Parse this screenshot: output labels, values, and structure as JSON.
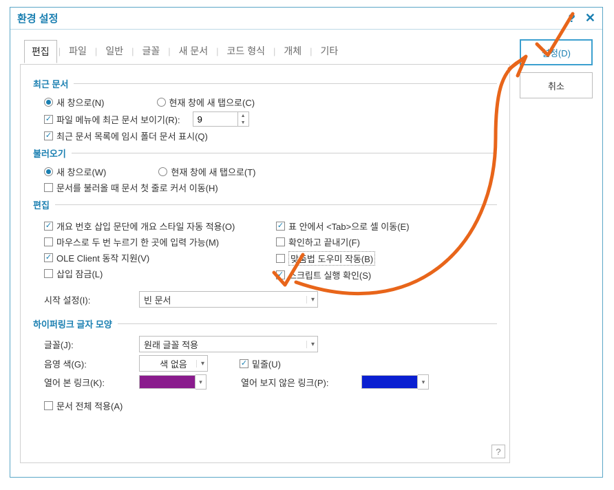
{
  "dialog": {
    "title": "환경 설정"
  },
  "buttons": {
    "ok": "설정(D)",
    "cancel": "취소"
  },
  "tabs": [
    "편집",
    "파일",
    "일반",
    "글꼴",
    "새 문서",
    "코드 형식",
    "개체",
    "기타"
  ],
  "sections": {
    "recent": {
      "title": "최근 문서"
    },
    "open": {
      "title": "불러오기"
    },
    "edit": {
      "title": "편집"
    },
    "hyperlink": {
      "title": "하이퍼링크 글자 모양"
    }
  },
  "labels": {
    "new_window_n": "새 창으로(N)",
    "new_tab_c": "현재 창에 새 탭으로(C)",
    "show_recent_menu_r": "파일 메뉴에 최근 문서 보이기(R):",
    "recent_count": "9",
    "show_temp_folder_q": "최근 문서 목록에 임시 폴더 문서 표시(Q)",
    "new_window_w": "새 창으로(W)",
    "new_tab_t": "현재 창에 새 탭으로(T)",
    "cursor_first_h": "문서를 불러올 때 문서 첫 줄로 커서 이동(H)",
    "outline_style_o": "개요 번호 삽입 문단에 개요 스타일 자동 적용(O)",
    "double_click_m": "마우스로 두 번 누르기 한 곳에 입력 가능(M)",
    "ole_v": "OLE Client 동작 지원(V)",
    "insert_lock_l": "삽입 잠금(L)",
    "tab_cell_e": "표 안에서 <Tab>으로 셀 이동(E)",
    "confirm_exit_f": "확인하고 끝내기(F)",
    "spellcheck_b": "맞춤법 도우미 작동(B)",
    "script_confirm_s": "스크립트 실행 확인(S)",
    "start_setting_i": "시작 설정(I):",
    "start_value": "빈 문서",
    "font_j": "글꼴(J):",
    "font_value": "원래 글꼴 적용",
    "shade_g": "음영 색(G):",
    "shade_value": "색 없음",
    "underline_u": "밑줄(U)",
    "visited_k": "열어 본 링크(K):",
    "unvisited_p": "열어 보지 않은 링크(P):",
    "apply_all_a": "문서 전체 적용(A)"
  },
  "colors": {
    "visited": "#8a1b8d",
    "unvisited": "#0a1fd1"
  },
  "checked": {
    "recent_radio_new": true,
    "recent_show_menu": true,
    "recent_temp": true,
    "open_radio_new": true,
    "cursor_first": false,
    "outline_style": true,
    "double_click": false,
    "ole": true,
    "insert_lock": false,
    "tab_cell": true,
    "confirm_exit": false,
    "spellcheck": false,
    "script_confirm": true,
    "underline": true,
    "apply_all": false
  }
}
